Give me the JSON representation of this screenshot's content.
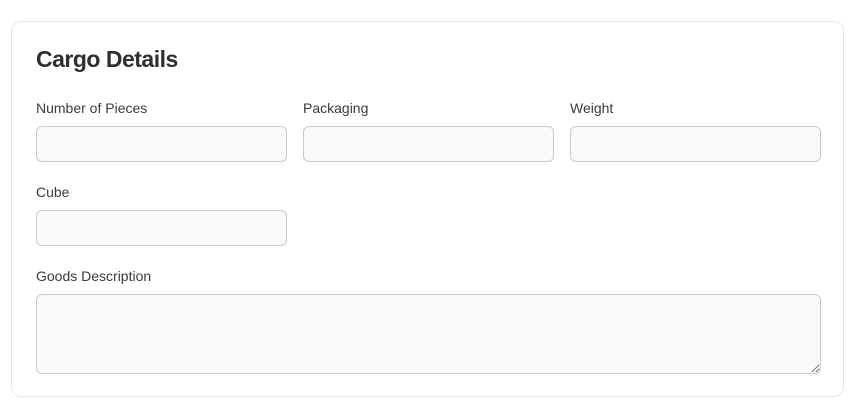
{
  "form": {
    "title": "Cargo Details",
    "fields": {
      "number_of_pieces": {
        "label": "Number of Pieces",
        "value": ""
      },
      "packaging": {
        "label": "Packaging",
        "value": ""
      },
      "weight": {
        "label": "Weight",
        "value": ""
      },
      "cube": {
        "label": "Cube",
        "value": ""
      },
      "goods_description": {
        "label": "Goods Description",
        "value": ""
      }
    }
  }
}
